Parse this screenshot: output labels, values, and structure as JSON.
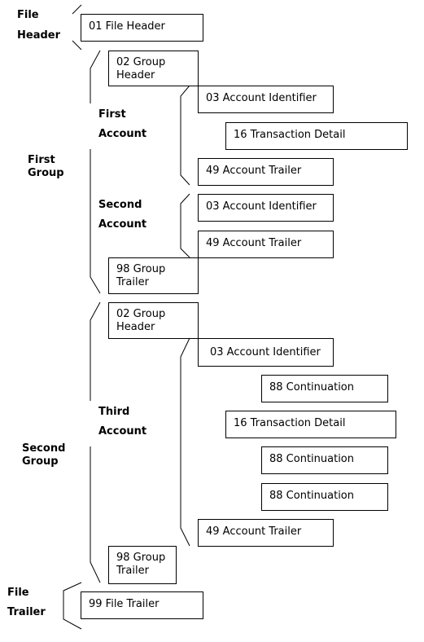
{
  "records": [
    {
      "id": "file-header",
      "text": "01 File Header"
    },
    {
      "id": "group-header-1",
      "text": "02 Group Header"
    },
    {
      "id": "account-identifier-1",
      "text": "03 Account Identifier"
    },
    {
      "id": "transaction-detail-1",
      "text": "16 Transaction Detail"
    },
    {
      "id": "account-trailer-1",
      "text": "49 Account Trailer"
    },
    {
      "id": "account-identifier-2",
      "text": "03 Account Identifier"
    },
    {
      "id": "account-trailer-2",
      "text": "49 Account Trailer"
    },
    {
      "id": "group-trailer-1",
      "text": "98 Group Trailer"
    },
    {
      "id": "group-header-2",
      "text": "02 Group Header"
    },
    {
      "id": "account-identifier-3",
      "text": "03 Account Identifier"
    },
    {
      "id": "continuation-1",
      "text": "88 Continuation"
    },
    {
      "id": "transaction-detail-2",
      "text": "16 Transaction Detail"
    },
    {
      "id": "continuation-2",
      "text": "88 Continuation"
    },
    {
      "id": "continuation-3",
      "text": "88 Continuation"
    },
    {
      "id": "account-trailer-3",
      "text": "49 Account Trailer"
    },
    {
      "id": "group-trailer-2",
      "text": "98 Group Trailer"
    },
    {
      "id": "file-trailer",
      "text": "99 File Trailer"
    }
  ],
  "labels": {
    "file_header": [
      "File",
      "Header"
    ],
    "first_account": [
      "First",
      "Account"
    ],
    "first_group": [
      "First",
      "Group"
    ],
    "second_account": [
      "Second",
      "Account"
    ],
    "third_account": [
      "Third",
      "Account"
    ],
    "second_group": [
      "Second",
      "Group"
    ],
    "file_trailer": [
      "File",
      "Trailer"
    ]
  }
}
